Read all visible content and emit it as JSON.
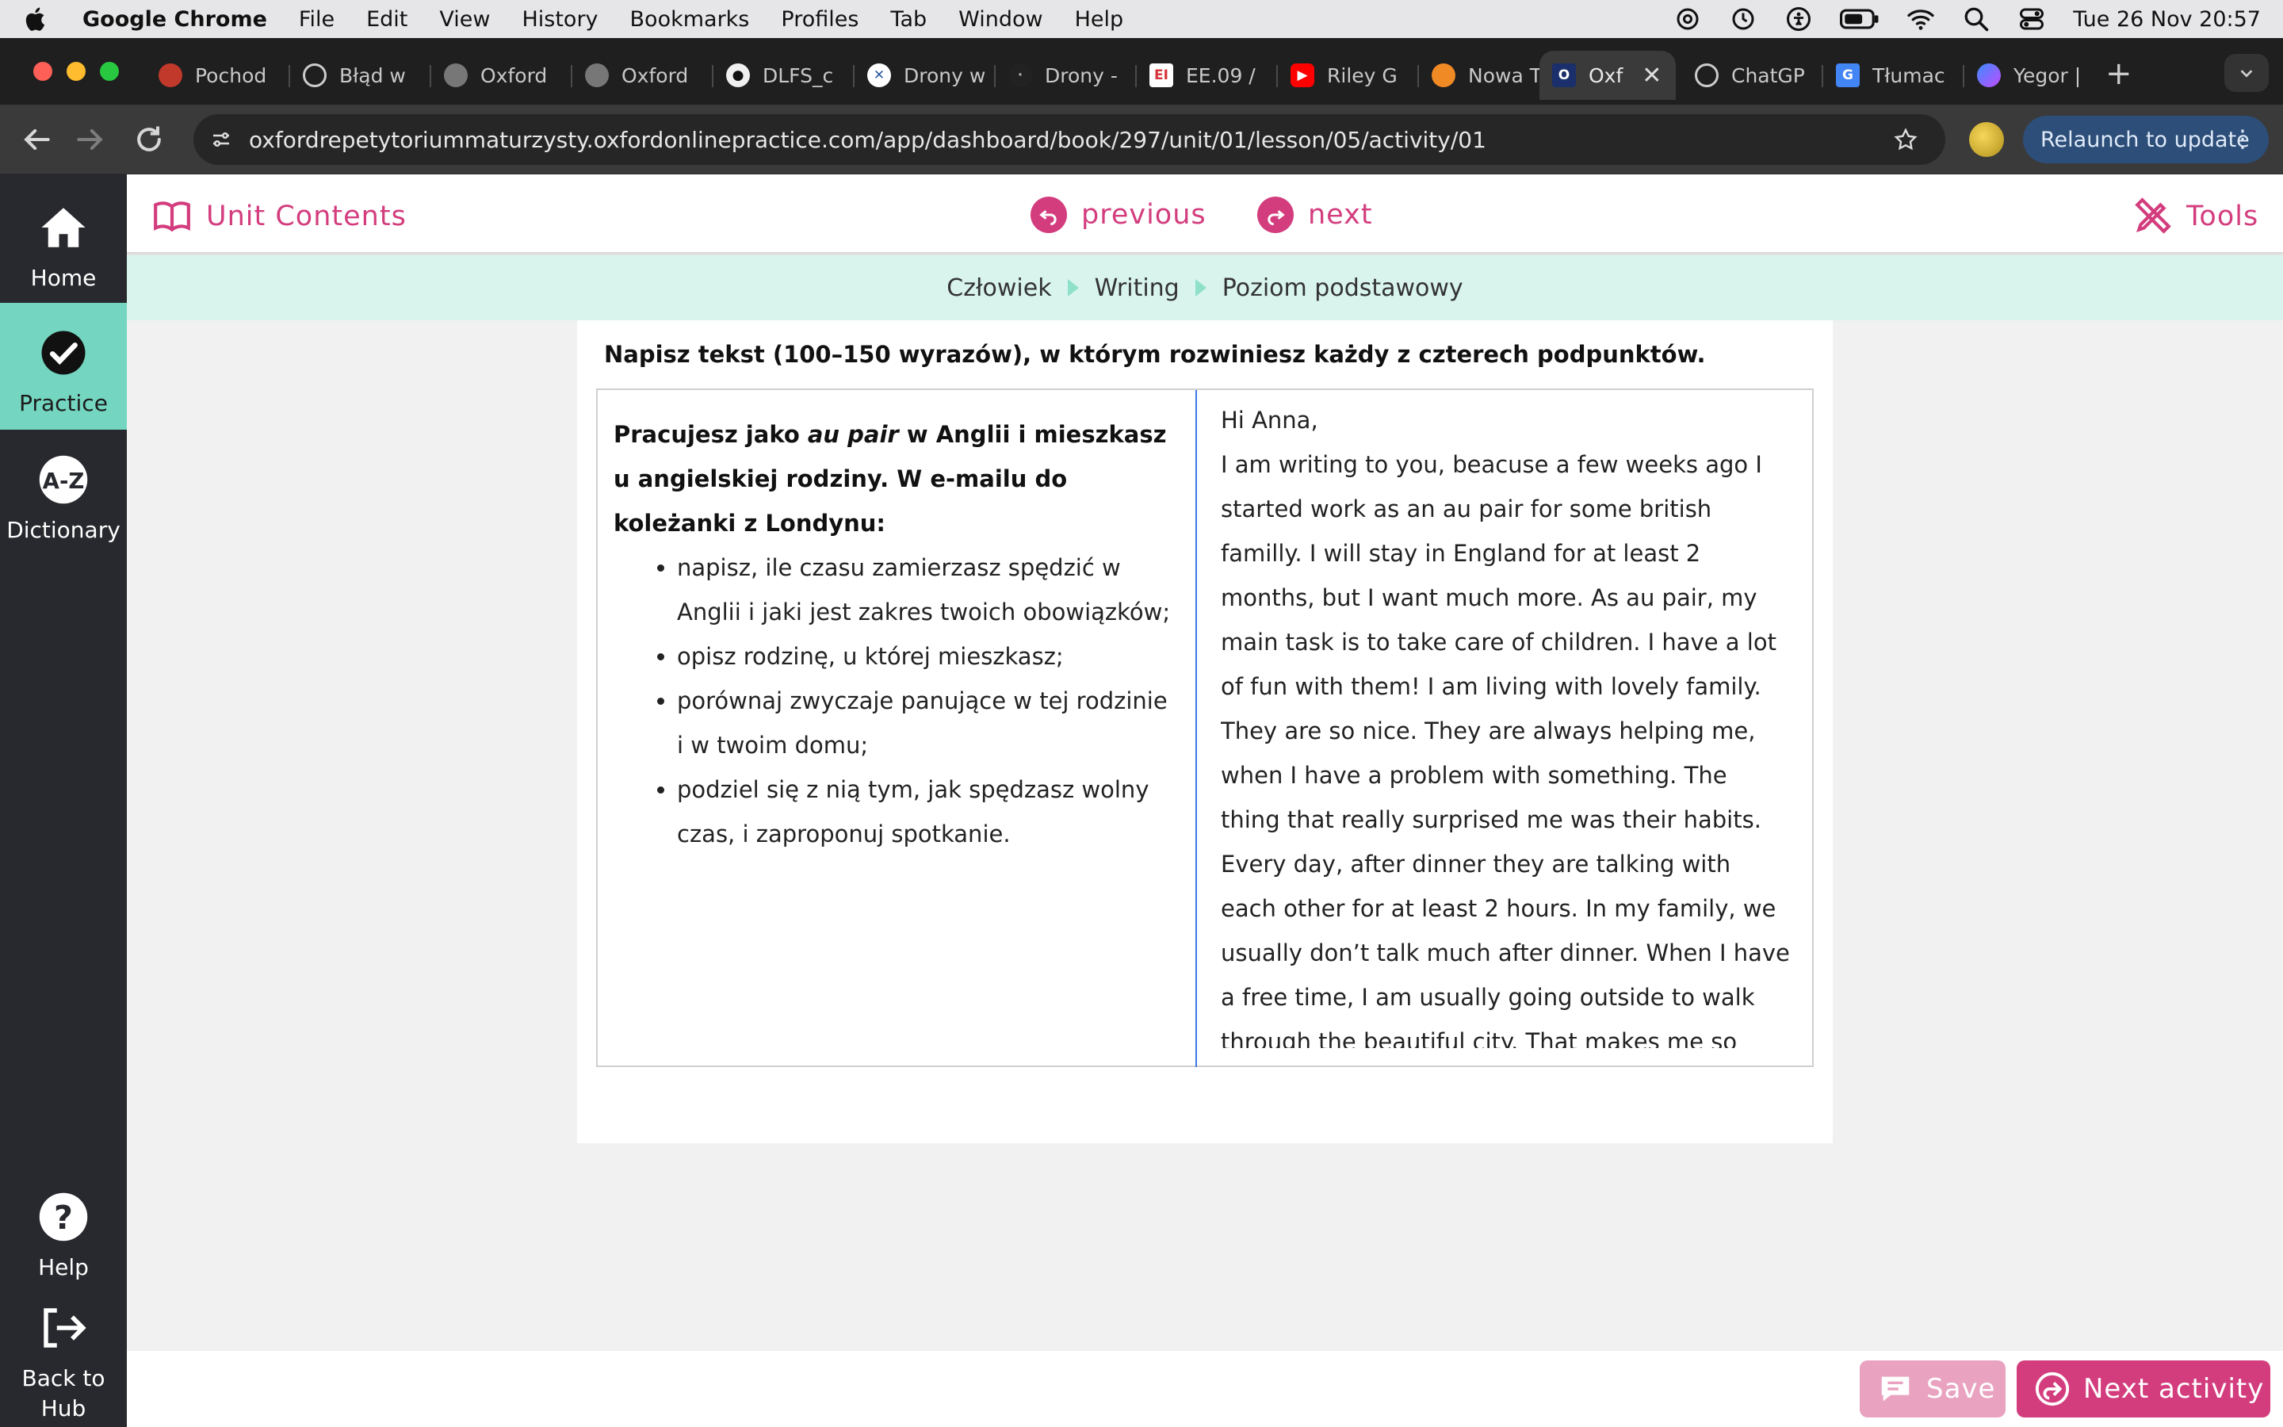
{
  "menubar": {
    "app_name": "Google Chrome",
    "menus": [
      "File",
      "Edit",
      "View",
      "History",
      "Bookmarks",
      "Profiles",
      "Tab",
      "Window",
      "Help"
    ],
    "clock": "Tue 26 Nov  20:57"
  },
  "tabs": [
    {
      "title": "Pochod",
      "favicon": "red-logo",
      "color": "#c0392b"
    },
    {
      "title": "Błąd w",
      "favicon": "openai-icon",
      "color": "#555555"
    },
    {
      "title": "Oxford",
      "favicon": "globe-icon",
      "color": "#777777"
    },
    {
      "title": "Oxford",
      "favicon": "globe-icon",
      "color": "#777777"
    },
    {
      "title": "DLFS_c",
      "favicon": "github-icon",
      "color": "#111111"
    },
    {
      "title": "Drony w",
      "favicon": "circle-icon",
      "color": "#ffffff"
    },
    {
      "title": "Drony -",
      "favicon": "dot-icon",
      "color": "#222222"
    },
    {
      "title": "EE.09 /",
      "favicon": "ei-icon",
      "color": "#d6343b"
    },
    {
      "title": "Riley G",
      "favicon": "youtube-icon",
      "color": "#ff0000"
    },
    {
      "title": "Nowa T",
      "favicon": "orange-icon",
      "color": "#f08a24"
    },
    {
      "title": "Oxf",
      "favicon": "oxford-icon",
      "color": "#1a2f6b",
      "active": true
    },
    {
      "title": "ChatGP",
      "favicon": "openai-icon",
      "color": "#555555"
    },
    {
      "title": "Tłumac",
      "favicon": "translate-icon",
      "color": "#4285f4"
    },
    {
      "title": "Yegor |",
      "favicon": "messenger-icon",
      "color": "#a34bff"
    }
  ],
  "toolbar": {
    "url": "oxfordrepetytoriummaturzysty.oxfordonlinepractice.com/app/dashboard/book/297/unit/01/lesson/05/activity/01",
    "relaunch_label": "Relaunch to update"
  },
  "sidebar": {
    "items": [
      {
        "label": "Home",
        "icon": "home-icon"
      },
      {
        "label": "Practice",
        "icon": "check-circle-icon",
        "active": true
      },
      {
        "label": "Dictionary",
        "icon": "a-z-icon"
      },
      {
        "label": "Help",
        "icon": "help-icon"
      },
      {
        "label": "Back to Hub",
        "icon": "exit-icon"
      }
    ]
  },
  "topnav": {
    "unit_contents": "Unit Contents",
    "previous": "previous",
    "next": "next",
    "tools": "Tools"
  },
  "breadcrumb": [
    "Człowiek",
    "Writing",
    "Poziom podstawowy"
  ],
  "activity": {
    "instruction": "Napisz tekst (100–150 wyrazów), w którym rozwiniesz każdy z czterech podpunktów.",
    "prompt_intro_1": "Pracujesz jako ",
    "prompt_intro_italic": "au pair",
    "prompt_intro_2": " w Anglii i mieszkasz u angielskiej rodziny. W e-mailu do koleżanki z Londynu:",
    "bullets": [
      "napisz, ile czasu zamierzasz spędzić w Anglii i jaki jest zakres twoich obowiązków;",
      "opisz rodzinę, u której mieszkasz;",
      "porównaj zwyczaje panujące w tej rodzinie i w twoim domu;",
      "podziel się z nią tym, jak spędzasz wolny czas, i zaproponuj spotkanie."
    ],
    "answer": "Hi Anna,\nI am writing to you, beacuse a few weeks ago I started work as an au pair for some british familly. I will stay in England for at least 2 months, but I want much more. As au pair, my main task is to take care of children. I have a lot of fun with them! I am living with lovely family. They are so nice. They are always helping me, when I have a problem with something. The thing that really surprised me was their habits. Every day, after dinner they are talking with each other for at least 2 hours. In my family, we usually don’t talk much after dinner. When I have a free time, I am usually going outside to walk through the beautiful city. That makes me so relax. Next weekend, I will go for a trip to London, maybe you want to meet?"
  },
  "footer": {
    "save": "Save",
    "next_activity": "Next activity"
  },
  "colors": {
    "accent": "#d33d7e",
    "practice_active": "#74d6c0",
    "breadcrumb_bg": "#d9f4ed"
  }
}
